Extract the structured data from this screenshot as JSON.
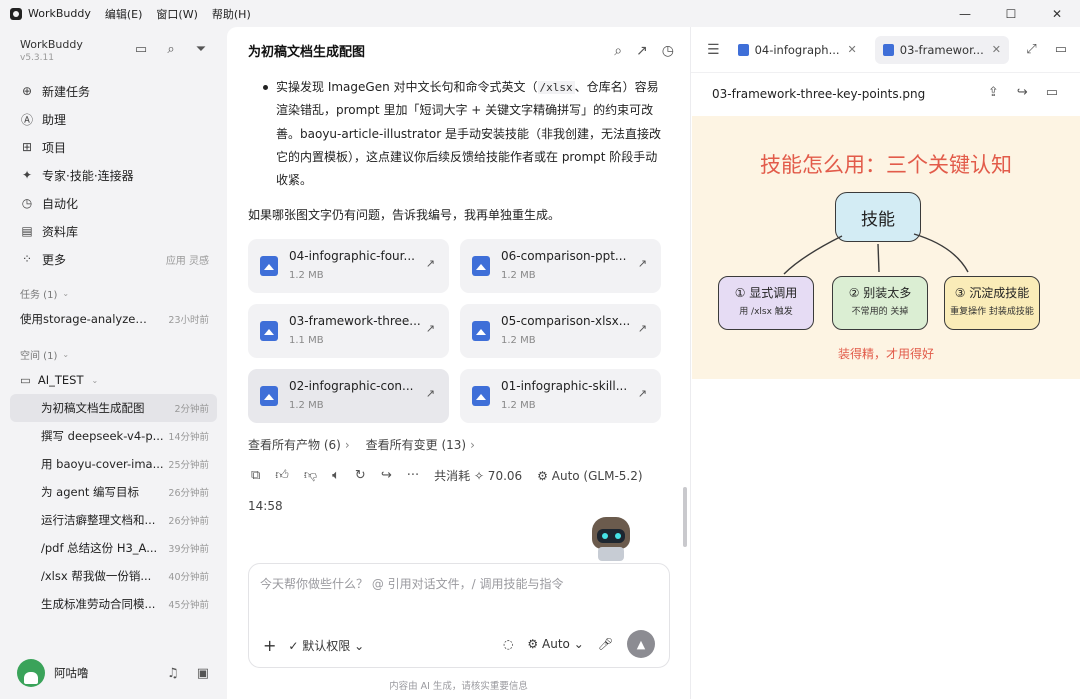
{
  "titlebar": {
    "app_name": "WorkBuddy",
    "menus": [
      "编辑(E)",
      "窗口(W)",
      "帮助(H)"
    ]
  },
  "sidebar": {
    "brand": "WorkBuddy",
    "version": "v5.3.11",
    "nav": [
      {
        "label": "新建任务",
        "icon": "plus-circle-icon"
      },
      {
        "label": "助理",
        "icon": "assistant-icon"
      },
      {
        "label": "项目",
        "icon": "project-icon"
      },
      {
        "label": "专家·技能·连接器",
        "icon": "expert-icon"
      },
      {
        "label": "自动化",
        "icon": "clock-icon"
      },
      {
        "label": "资料库",
        "icon": "book-icon"
      },
      {
        "label": "更多",
        "icon": "grid-icon",
        "extra": "应用  灵感"
      }
    ],
    "tasks_title": "任务 (1)",
    "tasks": [
      {
        "label": "使用storage-analyzer分...",
        "time": "23小时前"
      }
    ],
    "space_title": "空间 (1)",
    "folder": "AI_TEST",
    "space_items": [
      {
        "label": "为初稿文档生成配图",
        "time": "2分钟前",
        "active": true
      },
      {
        "label": "撰写 deepseek-v4-p...",
        "time": "14分钟前"
      },
      {
        "label": "用 baoyu-cover-ima...",
        "time": "25分钟前"
      },
      {
        "label": "为 agent 编写目标",
        "time": "26分钟前"
      },
      {
        "label": "运行洁癖整理文档和...",
        "time": "26分钟前"
      },
      {
        "label": "/pdf 总结这份 H3_A...",
        "time": "39分钟前"
      },
      {
        "label": "/xlsx 帮我做一份销...",
        "time": "40分钟前"
      },
      {
        "label": "生成标准劳动合同模...",
        "time": "45分钟前"
      }
    ],
    "user_name": "阿咕噜"
  },
  "main": {
    "title": "为初稿文档生成配图",
    "bullet_text_1": "实操发现 ImageGen 对中文长句和命令式英文（",
    "bullet_code": "/xlsx",
    "bullet_text_2": "、仓库名）容易渲染错乱，prompt 里加「短词大字 + 关键文字精确拼写」的约束可改善。baoyu-article-illustrator 是手动安装技能（非我创建，无法直接改它的内置模板），这点建议你后续反馈给技能作者或在 prompt 阶段手动收紧。",
    "followup": "如果哪张图文字仍有问题，告诉我编号，我再单独重生成。",
    "files": [
      {
        "name": "04-infographic-four...",
        "size": "1.2 MB"
      },
      {
        "name": "06-comparison-ppt...",
        "size": "1.2 MB"
      },
      {
        "name": "03-framework-three...",
        "size": "1.1 MB"
      },
      {
        "name": "05-comparison-xlsx...",
        "size": "1.2 MB"
      },
      {
        "name": "02-infographic-con...",
        "size": "1.2 MB"
      },
      {
        "name": "01-infographic-skill...",
        "size": "1.2 MB"
      }
    ],
    "link_artifacts": "查看所有产物 (6)",
    "link_changes": "查看所有变更 (13)",
    "usage": "共消耗 ✧ 70.06",
    "model": "Auto (GLM-5.2)",
    "timestamp": "14:58",
    "composer_placeholder": "今天帮你做些什么？ @ 引用对话文件，/ 调用技能与指令",
    "permission": "默认权限",
    "mode": "Auto",
    "disclaimer": "内容由 AI 生成，请核实重要信息"
  },
  "preview": {
    "tabs": [
      {
        "label": "04-infograph...",
        "active": false
      },
      {
        "label": "03-framewor...",
        "active": true
      }
    ],
    "filename": "03-framework-three-key-points.png",
    "image": {
      "heading": "技能怎么用：三个关键认知",
      "center": "技能",
      "boxes": [
        {
          "title": "① 显式调用",
          "sub": "用 /xlsx 触发"
        },
        {
          "title": "② 别装太多",
          "sub": "不常用的 关掉"
        },
        {
          "title": "③ 沉淀成技能",
          "sub": "重复操作 封装成技能"
        }
      ],
      "footer": "装得精，才用得好"
    }
  }
}
